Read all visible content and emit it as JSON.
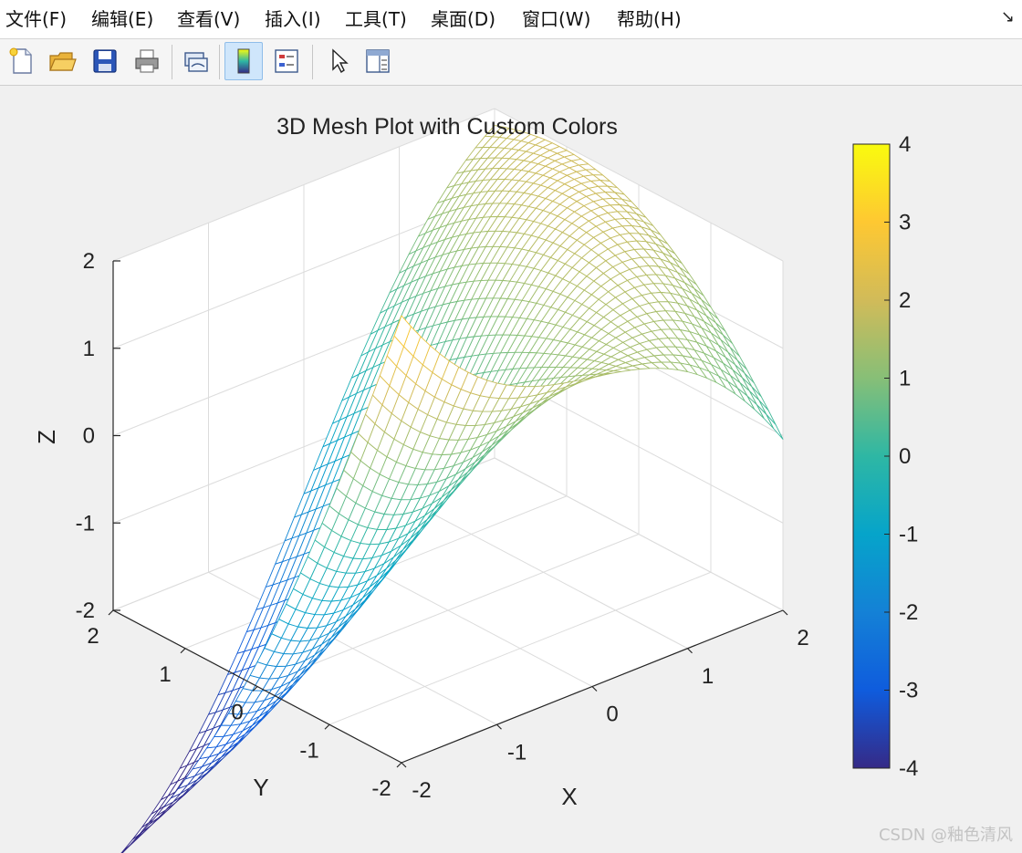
{
  "menubar": {
    "items": [
      {
        "id": "file",
        "label": "文件(F)"
      },
      {
        "id": "edit",
        "label": "编辑(E)"
      },
      {
        "id": "view",
        "label": "查看(V)"
      },
      {
        "id": "insert",
        "label": "插入(I)"
      },
      {
        "id": "tools",
        "label": "工具(T)"
      },
      {
        "id": "desktop",
        "label": "桌面(D)"
      },
      {
        "id": "window",
        "label": "窗口(W)"
      },
      {
        "id": "help",
        "label": "帮助(H)"
      }
    ],
    "expand_icon": "dock-arrow-icon"
  },
  "toolbar": {
    "buttons": [
      {
        "id": "new",
        "icon": "new-figure-icon"
      },
      {
        "id": "open",
        "icon": "open-folder-icon"
      },
      {
        "id": "save",
        "icon": "save-disk-icon"
      },
      {
        "id": "print",
        "icon": "printer-icon"
      },
      {
        "id": "link",
        "icon": "link-plot-icon"
      },
      {
        "id": "colorbar",
        "icon": "insert-colorbar-icon",
        "active": true
      },
      {
        "id": "legend",
        "icon": "insert-legend-icon"
      },
      {
        "id": "edit-plot",
        "icon": "pointer-arrow-icon"
      },
      {
        "id": "property",
        "icon": "property-inspector-icon"
      }
    ]
  },
  "chart_data": {
    "type": "mesh3d",
    "title": "3D Mesh Plot with Custom Colors",
    "xlabel": "X",
    "ylabel": "Y",
    "zlabel": "Z",
    "xlim": [
      -2,
      2
    ],
    "ylim": [
      -2,
      2
    ],
    "zlim": [
      -2,
      2
    ],
    "xticks": [
      "-2",
      "-1",
      "0",
      "1",
      "2"
    ],
    "yticks": [
      "-2",
      "-1",
      "0",
      "1",
      "2"
    ],
    "zticks": [
      "-2",
      "-1",
      "0",
      "1",
      "2"
    ],
    "grid": true,
    "grid_n": 41,
    "surface": "z = 2*sin(x)*cos(y/2) + 2*(x-1.25)*y/3.25 - 0.05*x",
    "colormap": "parula",
    "colormap_stops": [
      "#352a87",
      "#0f5cdd",
      "#1481d6",
      "#06a4ca",
      "#2eb7a4",
      "#87bf77",
      "#d1bb59",
      "#fec832",
      "#f9fb0e"
    ],
    "colorbar": {
      "clim": [
        -4,
        4
      ],
      "ticks": [
        "4",
        "3",
        "2",
        "1",
        "0",
        "-1",
        "-2",
        "-3",
        "-4"
      ],
      "placement": "right"
    }
  },
  "watermark": "CSDN @釉色清风"
}
